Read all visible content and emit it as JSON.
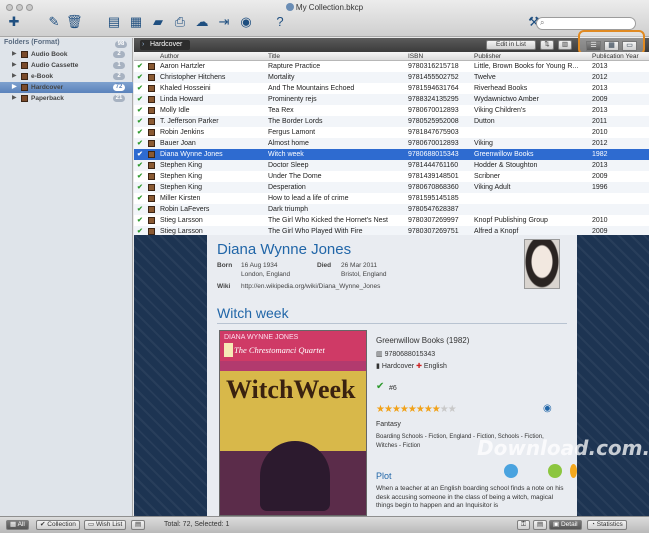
{
  "window": {
    "title": "My Collection.bkcp"
  },
  "search": {
    "placeholder": "",
    "value": ""
  },
  "sidebar": {
    "header": "Folders (Format)",
    "header_count": "98",
    "items": [
      {
        "label": "Audio Book",
        "count": "2"
      },
      {
        "label": "Audio Cassette",
        "count": "1"
      },
      {
        "label": "e-Book",
        "count": "2"
      },
      {
        "label": "Hardcover",
        "count": "72"
      },
      {
        "label": "Paperback",
        "count": "21"
      }
    ]
  },
  "toolbar": {
    "breadcrumb": "Hardcover",
    "edit_in_list": "Edit in List"
  },
  "table": {
    "columns": [
      "Author",
      "Title",
      "ISBN",
      "Publisher",
      "Publication Year"
    ],
    "rows": [
      {
        "author": "Aaron Hartzler",
        "title": "Rapture Practice",
        "isbn": "9780316215718",
        "publisher": "Little, Brown Books for Young R...",
        "year": "2013"
      },
      {
        "author": "Christopher Hitchens",
        "title": "Mortality",
        "isbn": "9781455502752",
        "publisher": "Twelve",
        "year": "2012"
      },
      {
        "author": "Khaled Hosseini",
        "title": "And The Mountains Echoed",
        "isbn": "9781594631764",
        "publisher": "Riverhead Books",
        "year": "2013"
      },
      {
        "author": "Linda Howard",
        "title": "Prominenty rejs",
        "isbn": "9788324135295",
        "publisher": "Wydawnictwo Amber",
        "year": "2009"
      },
      {
        "author": "Molly Idle",
        "title": "Tea Rex",
        "isbn": "9780670012893",
        "publisher": "Viking Children's",
        "year": "2013"
      },
      {
        "author": "T. Jefferson Parker",
        "title": "The Border Lords",
        "isbn": "9780525952008",
        "publisher": "Dutton",
        "year": "2011"
      },
      {
        "author": "Robin Jenkins",
        "title": "Fergus Lamont",
        "isbn": "9781847675903",
        "publisher": "",
        "year": "2010"
      },
      {
        "author": "Bauer Joan",
        "title": "Almost home",
        "isbn": "9780670012893",
        "publisher": "Viking",
        "year": "2012"
      },
      {
        "author": "Diana Wynne Jones",
        "title": "Witch week",
        "isbn": "9780688015343",
        "publisher": "Greenwillow Books",
        "year": "1982"
      },
      {
        "author": "Stephen King",
        "title": "Doctor Sleep",
        "isbn": "9781444761160",
        "publisher": "Hodder & Stoughton",
        "year": "2013"
      },
      {
        "author": "Stephen King",
        "title": "Under The Dome",
        "isbn": "9781439148501",
        "publisher": "Scribner",
        "year": "2009"
      },
      {
        "author": "Stephen King",
        "title": "Desperation",
        "isbn": "9780670868360",
        "publisher": "Viking Adult",
        "year": "1996"
      },
      {
        "author": "Miller Kirsten",
        "title": "How to lead a life of crime",
        "isbn": "9781595145185",
        "publisher": "",
        "year": ""
      },
      {
        "author": "Robin LaFevers",
        "title": "Dark triumph",
        "isbn": "9780547628387",
        "publisher": "",
        "year": ""
      },
      {
        "author": "Stieg Larsson",
        "title": "The Girl Who Kicked the Hornet's Nest",
        "isbn": "9780307269997",
        "publisher": "Knopf Publishing Group",
        "year": "2010"
      },
      {
        "author": "Stieg Larsson",
        "title": "The Girl Who Played With Fire",
        "isbn": "9780307269751",
        "publisher": "Alfred a Knopf",
        "year": "2009"
      }
    ]
  },
  "detail": {
    "author_name": "Diana Wynne Jones",
    "born_label": "Born",
    "born_date": "16 Aug 1934",
    "born_place": "London, England",
    "died_label": "Died",
    "died_date": "26 Mar 2011",
    "died_place": "Bristol, England",
    "wiki_label": "Wiki",
    "wiki_url": "http://en.wikipedia.org/wiki/Diana_Wynne_Jones",
    "book_title": "Witch week",
    "cover_series": "The Chrestomanci Quartet",
    "cover_author": "DIANA WYNNE JONES",
    "cover_title": "WitchWeek",
    "publisher_year": "Greenwillow Books (1982)",
    "isbn": "9780688015343",
    "format": "Hardcover",
    "language": "English",
    "number": "#6",
    "rating": 8,
    "rating_max": 10,
    "genre": "Fantasy",
    "subjects": "Boarding Schools - Fiction, England - Fiction, Schools - Fiction, Witches - Fiction",
    "plot_label": "Plot",
    "plot_text": "When a teacher at an English boarding school finds a note on his desk accusing someone in the class of being a witch, magical things begin to happen and an Inquisitor is"
  },
  "watermark": "Download.com.vn",
  "bottom": {
    "all": "All",
    "collection": "Collection",
    "wishlist": "Wish List",
    "status": "Total: 72, Selected: 1",
    "detail": "Detail",
    "statistics": "Statistics"
  },
  "colors": {
    "accent": "#2e6bd0",
    "highlight": "#e08a22",
    "heading": "#2166a8"
  }
}
